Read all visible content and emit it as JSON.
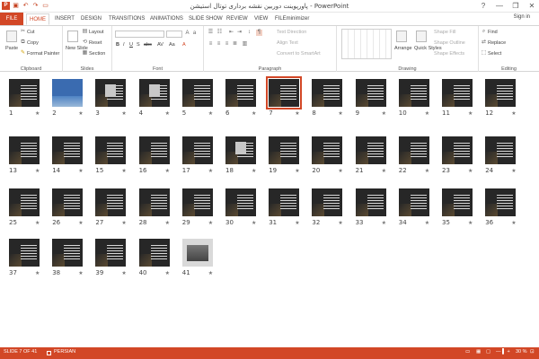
{
  "window": {
    "title": "پاورپوینت دوربین نقشه برداری توتال استیشن - PowerPoint",
    "controls": [
      "?",
      "—",
      "❐",
      "✕"
    ]
  },
  "quick_access": [
    "save",
    "undo",
    "redo",
    "start"
  ],
  "tabs": [
    "FILE",
    "HOME",
    "INSERT",
    "DESIGN",
    "TRANSITIONS",
    "ANIMATIONS",
    "SLIDE SHOW",
    "REVIEW",
    "VIEW",
    "FILEminimizer"
  ],
  "active_tab": "HOME",
  "sign_in": "Sign in",
  "ribbon": {
    "clipboard": {
      "label": "Clipboard",
      "paste": "Paste",
      "cut": "Cut",
      "copy": "Copy",
      "format_painter": "Format Painter"
    },
    "slides": {
      "label": "Slides",
      "new_slide": "New Slide",
      "layout": "Layout",
      "reset": "Reset",
      "section": "Section"
    },
    "font": {
      "label": "Font"
    },
    "paragraph": {
      "label": "Paragraph",
      "text_direction": "Text Direction",
      "align_text": "Align Text",
      "convert": "Convert to SmartArt"
    },
    "drawing": {
      "label": "Drawing",
      "arrange": "Arrange",
      "quick_styles": "Quick Styles",
      "shape_fill": "Shape Fill",
      "shape_outline": "Shape Outline",
      "shape_effects": "Shape Effects"
    },
    "editing": {
      "label": "Editing",
      "find": "Find",
      "replace": "Replace",
      "select": "Select"
    }
  },
  "slides": {
    "total": 41,
    "selected": 7,
    "numbers": [
      "1",
      "2",
      "3",
      "4",
      "5",
      "6",
      "7",
      "8",
      "9",
      "10",
      "11",
      "12",
      "13",
      "14",
      "15",
      "16",
      "17",
      "18",
      "19",
      "20",
      "21",
      "22",
      "23",
      "24",
      "25",
      "26",
      "27",
      "28",
      "29",
      "30",
      "31",
      "32",
      "33",
      "34",
      "35",
      "36",
      "37",
      "38",
      "39",
      "40",
      "41"
    ],
    "star": "★"
  },
  "status": {
    "slide_info": "SLIDE 7 OF 41",
    "language": "PERSIAN",
    "zoom": "30 %"
  },
  "colors": {
    "accent": "#d24726",
    "slide_bg": "#272727"
  }
}
